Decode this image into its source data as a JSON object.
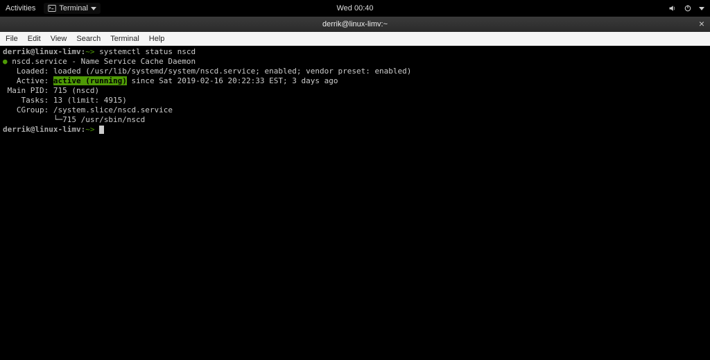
{
  "topbar": {
    "activities": "Activities",
    "app_name": "Terminal",
    "clock": "Wed 00:40"
  },
  "window": {
    "title": "derrik@linux-limv:~"
  },
  "menubar": {
    "file": "File",
    "edit": "Edit",
    "view": "View",
    "search": "Search",
    "terminal": "Terminal",
    "help": "Help"
  },
  "term": {
    "prompt1_user": "derrik@linux-limv:",
    "prompt1_path": "~>",
    "cmd1": " systemctl status nscd",
    "bullet": "●",
    "svc_line": " nscd.service - Name Service Cache Daemon",
    "loaded_label": "   Loaded: ",
    "loaded_value": "loaded (/usr/lib/systemd/system/nscd.service; enabled; vendor preset: enabled)",
    "active_label": "   Active: ",
    "active_status": "active (running)",
    "active_rest": " since Sat 2019-02-16 20:22:33 EST; 3 days ago",
    "pid_label": " Main PID: ",
    "pid_value": "715 (nscd)",
    "tasks_label": "    Tasks: ",
    "tasks_value": "13 (limit: 4915)",
    "cgroup_label": "   CGroup: ",
    "cgroup_value": "/system.slice/nscd.service",
    "cgroup_tree": "           └─715 /usr/sbin/nscd",
    "prompt2_user": "derrik@linux-limv:",
    "prompt2_path": "~>"
  }
}
